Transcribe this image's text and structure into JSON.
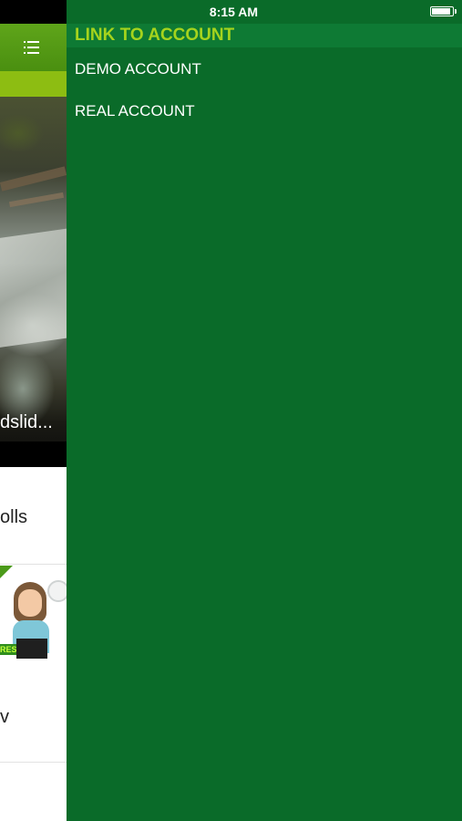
{
  "status_bar": {
    "time": "8:15 AM",
    "battery_level": 0.9
  },
  "drawer": {
    "title": "LINK TO ACCOUNT",
    "items": [
      {
        "label": "DEMO ACCOUNT"
      },
      {
        "label": "REAL ACCOUNT"
      }
    ],
    "colors": {
      "background": "#0a6b29",
      "header_background": "#0e7a34",
      "title_text": "#a5d31d",
      "item_text": "#ffffff"
    }
  },
  "background_app": {
    "nav_bar": {
      "menu_icon": "hamburger-menu-icon",
      "color": "#5fa51a"
    },
    "sub_bar_color": "#8dbd12",
    "photo_caption": "dslid...",
    "list_items": [
      {
        "label": "olls"
      },
      {
        "label": "v"
      }
    ],
    "illustration_tag": "RES"
  }
}
